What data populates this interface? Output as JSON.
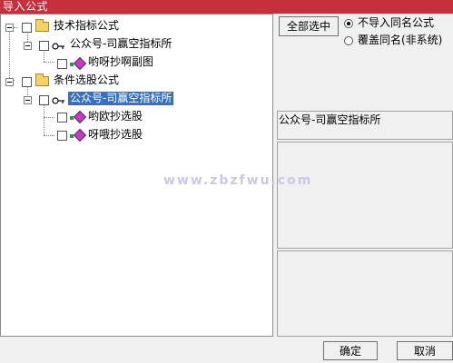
{
  "window": {
    "title": "导入公式"
  },
  "tree": {
    "nodes": [
      {
        "label": "技术指标公式"
      },
      {
        "label": "公众号-司赢空指标所"
      },
      {
        "label": "哟呀抄啊副图"
      },
      {
        "label": "条件选股公式"
      },
      {
        "label": "公众号-司赢空指标所"
      },
      {
        "label": "哟欧抄选股"
      },
      {
        "label": "呀哦抄选股"
      }
    ]
  },
  "side": {
    "select_all_label": "全部选中",
    "options": [
      {
        "label": "不导入同名公式",
        "selected": true
      },
      {
        "label": "覆盖同名(非系统)",
        "selected": false
      }
    ],
    "info_text": "公众号-司赢空指标所"
  },
  "watermark": "www.zbzfwu.com",
  "footer": {
    "ok_label": "确定",
    "cancel_label": "取消"
  },
  "colors": {
    "title_bar": "#c6303a",
    "selection": "#3470c8",
    "leaf_icon": "#c23cc6"
  }
}
